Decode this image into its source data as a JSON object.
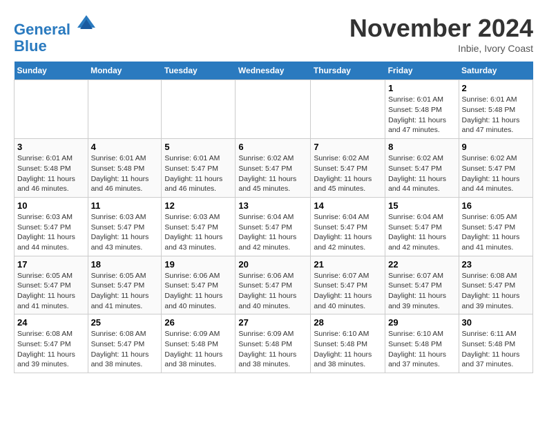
{
  "header": {
    "logo_line1": "General",
    "logo_line2": "Blue",
    "month": "November 2024",
    "location": "Inbie, Ivory Coast"
  },
  "days_of_week": [
    "Sunday",
    "Monday",
    "Tuesday",
    "Wednesday",
    "Thursday",
    "Friday",
    "Saturday"
  ],
  "weeks": [
    [
      {
        "day": "",
        "empty": true
      },
      {
        "day": "",
        "empty": true
      },
      {
        "day": "",
        "empty": true
      },
      {
        "day": "",
        "empty": true
      },
      {
        "day": "",
        "empty": true
      },
      {
        "day": "1",
        "sunrise": "6:01 AM",
        "sunset": "5:48 PM",
        "daylight": "11 hours and 47 minutes."
      },
      {
        "day": "2",
        "sunrise": "6:01 AM",
        "sunset": "5:48 PM",
        "daylight": "11 hours and 47 minutes."
      }
    ],
    [
      {
        "day": "3",
        "sunrise": "6:01 AM",
        "sunset": "5:48 PM",
        "daylight": "11 hours and 46 minutes."
      },
      {
        "day": "4",
        "sunrise": "6:01 AM",
        "sunset": "5:48 PM",
        "daylight": "11 hours and 46 minutes."
      },
      {
        "day": "5",
        "sunrise": "6:01 AM",
        "sunset": "5:47 PM",
        "daylight": "11 hours and 46 minutes."
      },
      {
        "day": "6",
        "sunrise": "6:02 AM",
        "sunset": "5:47 PM",
        "daylight": "11 hours and 45 minutes."
      },
      {
        "day": "7",
        "sunrise": "6:02 AM",
        "sunset": "5:47 PM",
        "daylight": "11 hours and 45 minutes."
      },
      {
        "day": "8",
        "sunrise": "6:02 AM",
        "sunset": "5:47 PM",
        "daylight": "11 hours and 44 minutes."
      },
      {
        "day": "9",
        "sunrise": "6:02 AM",
        "sunset": "5:47 PM",
        "daylight": "11 hours and 44 minutes."
      }
    ],
    [
      {
        "day": "10",
        "sunrise": "6:03 AM",
        "sunset": "5:47 PM",
        "daylight": "11 hours and 44 minutes."
      },
      {
        "day": "11",
        "sunrise": "6:03 AM",
        "sunset": "5:47 PM",
        "daylight": "11 hours and 43 minutes."
      },
      {
        "day": "12",
        "sunrise": "6:03 AM",
        "sunset": "5:47 PM",
        "daylight": "11 hours and 43 minutes."
      },
      {
        "day": "13",
        "sunrise": "6:04 AM",
        "sunset": "5:47 PM",
        "daylight": "11 hours and 42 minutes."
      },
      {
        "day": "14",
        "sunrise": "6:04 AM",
        "sunset": "5:47 PM",
        "daylight": "11 hours and 42 minutes."
      },
      {
        "day": "15",
        "sunrise": "6:04 AM",
        "sunset": "5:47 PM",
        "daylight": "11 hours and 42 minutes."
      },
      {
        "day": "16",
        "sunrise": "6:05 AM",
        "sunset": "5:47 PM",
        "daylight": "11 hours and 41 minutes."
      }
    ],
    [
      {
        "day": "17",
        "sunrise": "6:05 AM",
        "sunset": "5:47 PM",
        "daylight": "11 hours and 41 minutes."
      },
      {
        "day": "18",
        "sunrise": "6:05 AM",
        "sunset": "5:47 PM",
        "daylight": "11 hours and 41 minutes."
      },
      {
        "day": "19",
        "sunrise": "6:06 AM",
        "sunset": "5:47 PM",
        "daylight": "11 hours and 40 minutes."
      },
      {
        "day": "20",
        "sunrise": "6:06 AM",
        "sunset": "5:47 PM",
        "daylight": "11 hours and 40 minutes."
      },
      {
        "day": "21",
        "sunrise": "6:07 AM",
        "sunset": "5:47 PM",
        "daylight": "11 hours and 40 minutes."
      },
      {
        "day": "22",
        "sunrise": "6:07 AM",
        "sunset": "5:47 PM",
        "daylight": "11 hours and 39 minutes."
      },
      {
        "day": "23",
        "sunrise": "6:08 AM",
        "sunset": "5:47 PM",
        "daylight": "11 hours and 39 minutes."
      }
    ],
    [
      {
        "day": "24",
        "sunrise": "6:08 AM",
        "sunset": "5:47 PM",
        "daylight": "11 hours and 39 minutes."
      },
      {
        "day": "25",
        "sunrise": "6:08 AM",
        "sunset": "5:47 PM",
        "daylight": "11 hours and 38 minutes."
      },
      {
        "day": "26",
        "sunrise": "6:09 AM",
        "sunset": "5:48 PM",
        "daylight": "11 hours and 38 minutes."
      },
      {
        "day": "27",
        "sunrise": "6:09 AM",
        "sunset": "5:48 PM",
        "daylight": "11 hours and 38 minutes."
      },
      {
        "day": "28",
        "sunrise": "6:10 AM",
        "sunset": "5:48 PM",
        "daylight": "11 hours and 38 minutes."
      },
      {
        "day": "29",
        "sunrise": "6:10 AM",
        "sunset": "5:48 PM",
        "daylight": "11 hours and 37 minutes."
      },
      {
        "day": "30",
        "sunrise": "6:11 AM",
        "sunset": "5:48 PM",
        "daylight": "11 hours and 37 minutes."
      }
    ]
  ]
}
